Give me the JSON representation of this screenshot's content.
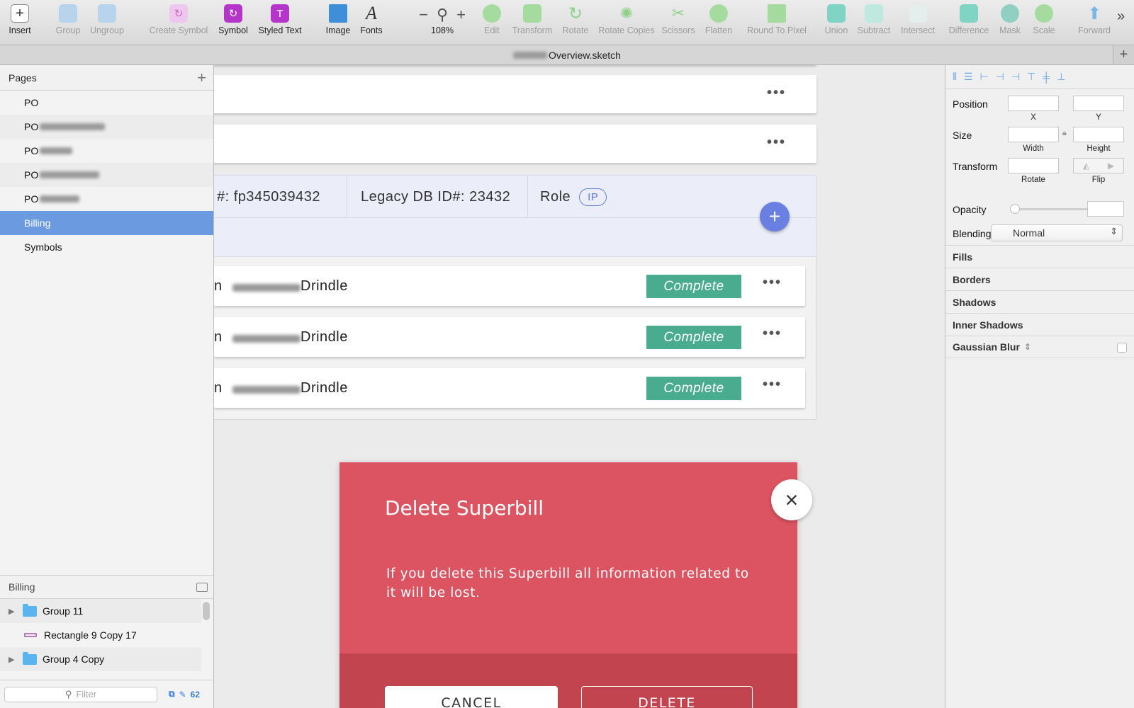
{
  "toolbar": {
    "insert": "Insert",
    "group": "Group",
    "ungroup": "Ungroup",
    "create_symbol": "Create Symbol",
    "symbol": "Symbol",
    "styled_text": "Styled Text",
    "image": "Image",
    "fonts": "Fonts",
    "zoom_minus": "−",
    "zoom_plus": "+",
    "zoom_level": "108%",
    "edit": "Edit",
    "transform": "Transform",
    "rotate": "Rotate",
    "rotate_copies": "Rotate Copies",
    "scissors": "Scissors",
    "flatten": "Flatten",
    "round_to_pixel": "Round To Pixel",
    "union": "Union",
    "subtract": "Subtract",
    "intersect": "Intersect",
    "difference": "Difference",
    "mask": "Mask",
    "scale": "Scale",
    "forward": "Forward",
    "more": "»"
  },
  "window": {
    "title_suffix": "Overview.sketch"
  },
  "pages": {
    "header": "Pages",
    "items": [
      {
        "label": "PO"
      },
      {
        "label": "PO"
      },
      {
        "label": "PO"
      },
      {
        "label": "PO"
      },
      {
        "label": "PO"
      },
      {
        "label": "Billing"
      },
      {
        "label": "Symbols"
      }
    ],
    "selected": "Billing"
  },
  "layers": {
    "header": "Billing",
    "items": [
      {
        "label": "Group 11"
      },
      {
        "label": "Rectangle 9 Copy 17"
      },
      {
        "label": "Group 4 Copy"
      }
    ],
    "filter_placeholder": "Filter",
    "count": "62"
  },
  "canvas": {
    "info": {
      "id_text": "#: fp345039432",
      "legacy_text": "Legacy DB ID#: 23432",
      "role_label": "Role",
      "role_value": "IP"
    },
    "patients": [
      {
        "lead": "n",
        "name": "Drindle",
        "status": "Complete"
      },
      {
        "lead": "n",
        "name": "Drindle",
        "status": "Complete"
      },
      {
        "lead": "n",
        "name": "Drindle",
        "status": "Complete"
      }
    ],
    "more": "•••",
    "fab": "+"
  },
  "modal": {
    "title": "Delete Superbill",
    "body": "If  you delete this Superbill all information related to it will be lost.",
    "cancel": "CANCEL",
    "delete": "DELETE",
    "close": "×"
  },
  "inspector": {
    "position": "Position",
    "x": "X",
    "y": "Y",
    "size": "Size",
    "width": "Width",
    "height": "Height",
    "transform": "Transform",
    "rotate": "Rotate",
    "flip": "Flip",
    "opacity": "Opacity",
    "blending": "Blending",
    "blending_value": "Normal",
    "fills": "Fills",
    "borders": "Borders",
    "shadows": "Shadows",
    "inner_shadows": "Inner Shadows",
    "gaussian_blur": "Gaussian Blur"
  },
  "colors": {
    "accent": "#6b9ae0",
    "status_complete": "#4aac8f",
    "modal_bg": "#dc5461",
    "modal_footer": "#c1444f",
    "fab": "#6a7fe2"
  }
}
